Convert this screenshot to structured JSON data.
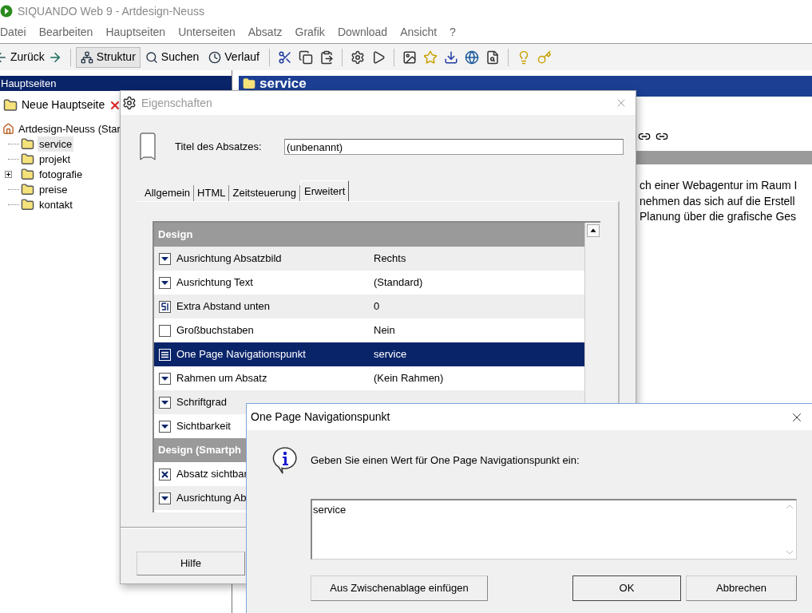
{
  "window": {
    "title": "SIQUANDO Web 9 - Artdesign-Neuss"
  },
  "menu": [
    "Datei",
    "Bearbeiten",
    "Hauptseiten",
    "Unterseiten",
    "Absatz",
    "Grafik",
    "Download",
    "Ansicht",
    "?"
  ],
  "toolbar": {
    "back": "Zurück",
    "views": [
      {
        "label": "Struktur",
        "selected": true
      },
      {
        "label": "Suchen",
        "selected": false
      },
      {
        "label": "Verlauf",
        "selected": false
      }
    ]
  },
  "sidebar": {
    "header": "Hauptseiten",
    "new_button": "Neue Hauptseite",
    "root": "Artdesign-Neuss (Star",
    "tree": [
      {
        "label": "service",
        "selected": true,
        "collapsed": false
      },
      {
        "label": "projekt",
        "selected": false,
        "collapsed": false
      },
      {
        "label": "fotografie",
        "selected": false,
        "collapsed": true
      },
      {
        "label": "preise",
        "selected": false,
        "collapsed": false
      },
      {
        "label": "kontakt",
        "selected": false,
        "collapsed": false
      }
    ]
  },
  "content": {
    "title": "service",
    "text_lines": [
      "ch einer Webagentur im Raum I",
      "nehmen das sich auf die Erstell",
      "Planung über die grafische Ges"
    ]
  },
  "properties_dialog": {
    "title": "Eigenschaften",
    "title_label": "Titel des Absatzes:",
    "title_value": "(unbenannt)",
    "tabs": [
      {
        "label": "Allgemein",
        "selected": false
      },
      {
        "label": "HTML",
        "selected": false
      },
      {
        "label": "Zeitsteuerung",
        "selected": false
      },
      {
        "label": "Erweitert",
        "selected": true
      }
    ],
    "grid": [
      {
        "kind": "section",
        "label": "Design"
      },
      {
        "kind": "dropdown",
        "label": "Ausrichtung Absatzbild",
        "value": "Rechts",
        "selected": false
      },
      {
        "kind": "dropdown",
        "label": "Ausrichtung Text",
        "value": "(Standard)",
        "selected": false
      },
      {
        "kind": "number",
        "label": "Extra Abstand unten",
        "value": "0",
        "selected": false
      },
      {
        "kind": "checkbox",
        "label": "Großbuchstaben",
        "value": "Nein",
        "checked": false,
        "selected": false
      },
      {
        "kind": "list",
        "label": "One Page Navigationspunkt",
        "value": "service",
        "selected": true
      },
      {
        "kind": "dropdown",
        "label": "Rahmen um Absatz",
        "value": "(Kein Rahmen)",
        "selected": false
      },
      {
        "kind": "dropdown",
        "label": "Schriftgrad",
        "selected": false
      },
      {
        "kind": "dropdown",
        "label": "Sichtbarkeit",
        "selected": false
      },
      {
        "kind": "section",
        "label": "Design (Smartph"
      },
      {
        "kind": "checkbox",
        "label": "Absatz sichtbar",
        "checked": true,
        "selected": false
      },
      {
        "kind": "dropdown",
        "label": "Ausrichtung Ab",
        "selected": false
      }
    ],
    "help_button": "Hilfe"
  },
  "input_dialog": {
    "title": "One Page Navigationspunkt",
    "message": "Geben Sie einen Wert für One Page Navigationspunkt ein:",
    "value": "service",
    "paste_button": "Aus Zwischenablage einfügen",
    "ok_button": "OK",
    "cancel_button": "Abbrechen"
  }
}
